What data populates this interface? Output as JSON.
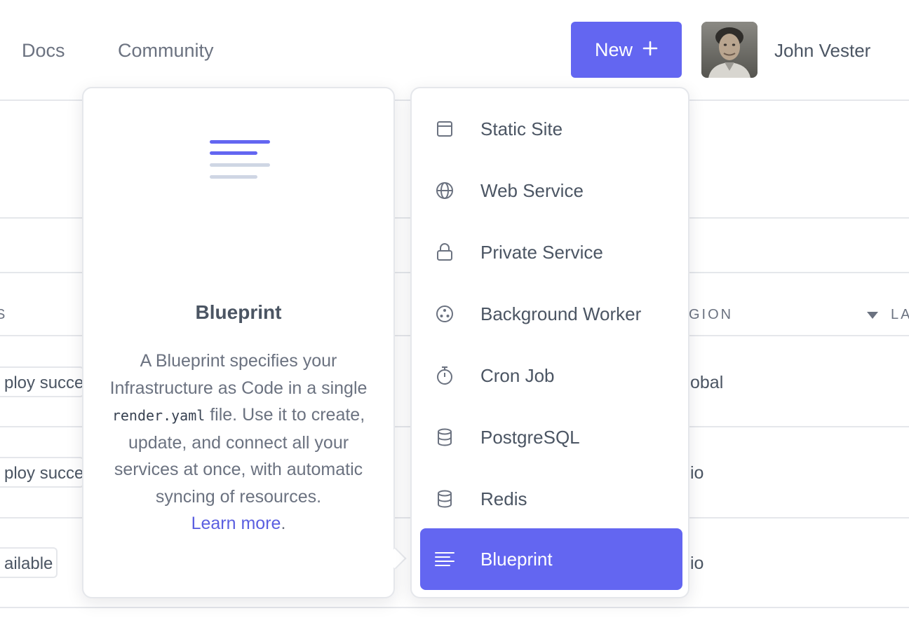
{
  "header": {
    "nav": [
      {
        "label": "Docs"
      },
      {
        "label": "Community"
      }
    ],
    "new_button": {
      "label": "New",
      "icon": "plus-icon"
    },
    "user": {
      "name": "John Vester",
      "avatar": "user-photo"
    }
  },
  "background_table": {
    "headers": [
      "S",
      "GION",
      "LA"
    ],
    "rows": [
      {
        "status": "ploy succe",
        "region": "obal"
      },
      {
        "status": "ploy succe",
        "region": "io"
      },
      {
        "status": "ailable",
        "region": "io"
      }
    ]
  },
  "info_card": {
    "icon": "blueprint-illustration-icon",
    "title": "Blueprint",
    "text_before": "A Blueprint specifies your Infrastructure as Code in a single ",
    "code": "render.yaml",
    "text_after": " file. Use it to create, update, and connect all your services at once, with automatic syncing of resources.",
    "learn_more": "Learn more",
    "learn_more_suffix": "."
  },
  "menu": {
    "items": [
      {
        "label": "Static Site",
        "icon": "browser-window-icon"
      },
      {
        "label": "Web Service",
        "icon": "globe-icon"
      },
      {
        "label": "Private Service",
        "icon": "lock-icon"
      },
      {
        "label": "Background Worker",
        "icon": "worker-icon"
      },
      {
        "label": "Cron Job",
        "icon": "stopwatch-icon"
      },
      {
        "label": "PostgreSQL",
        "icon": "database-icon"
      },
      {
        "label": "Redis",
        "icon": "database-icon"
      },
      {
        "label": "Blueprint",
        "icon": "blueprint-lines-icon",
        "active": true
      }
    ]
  },
  "colors": {
    "accent": "#6366f1",
    "link": "#5b5fe0",
    "border": "#e5e7eb",
    "text": "#4b5563"
  }
}
